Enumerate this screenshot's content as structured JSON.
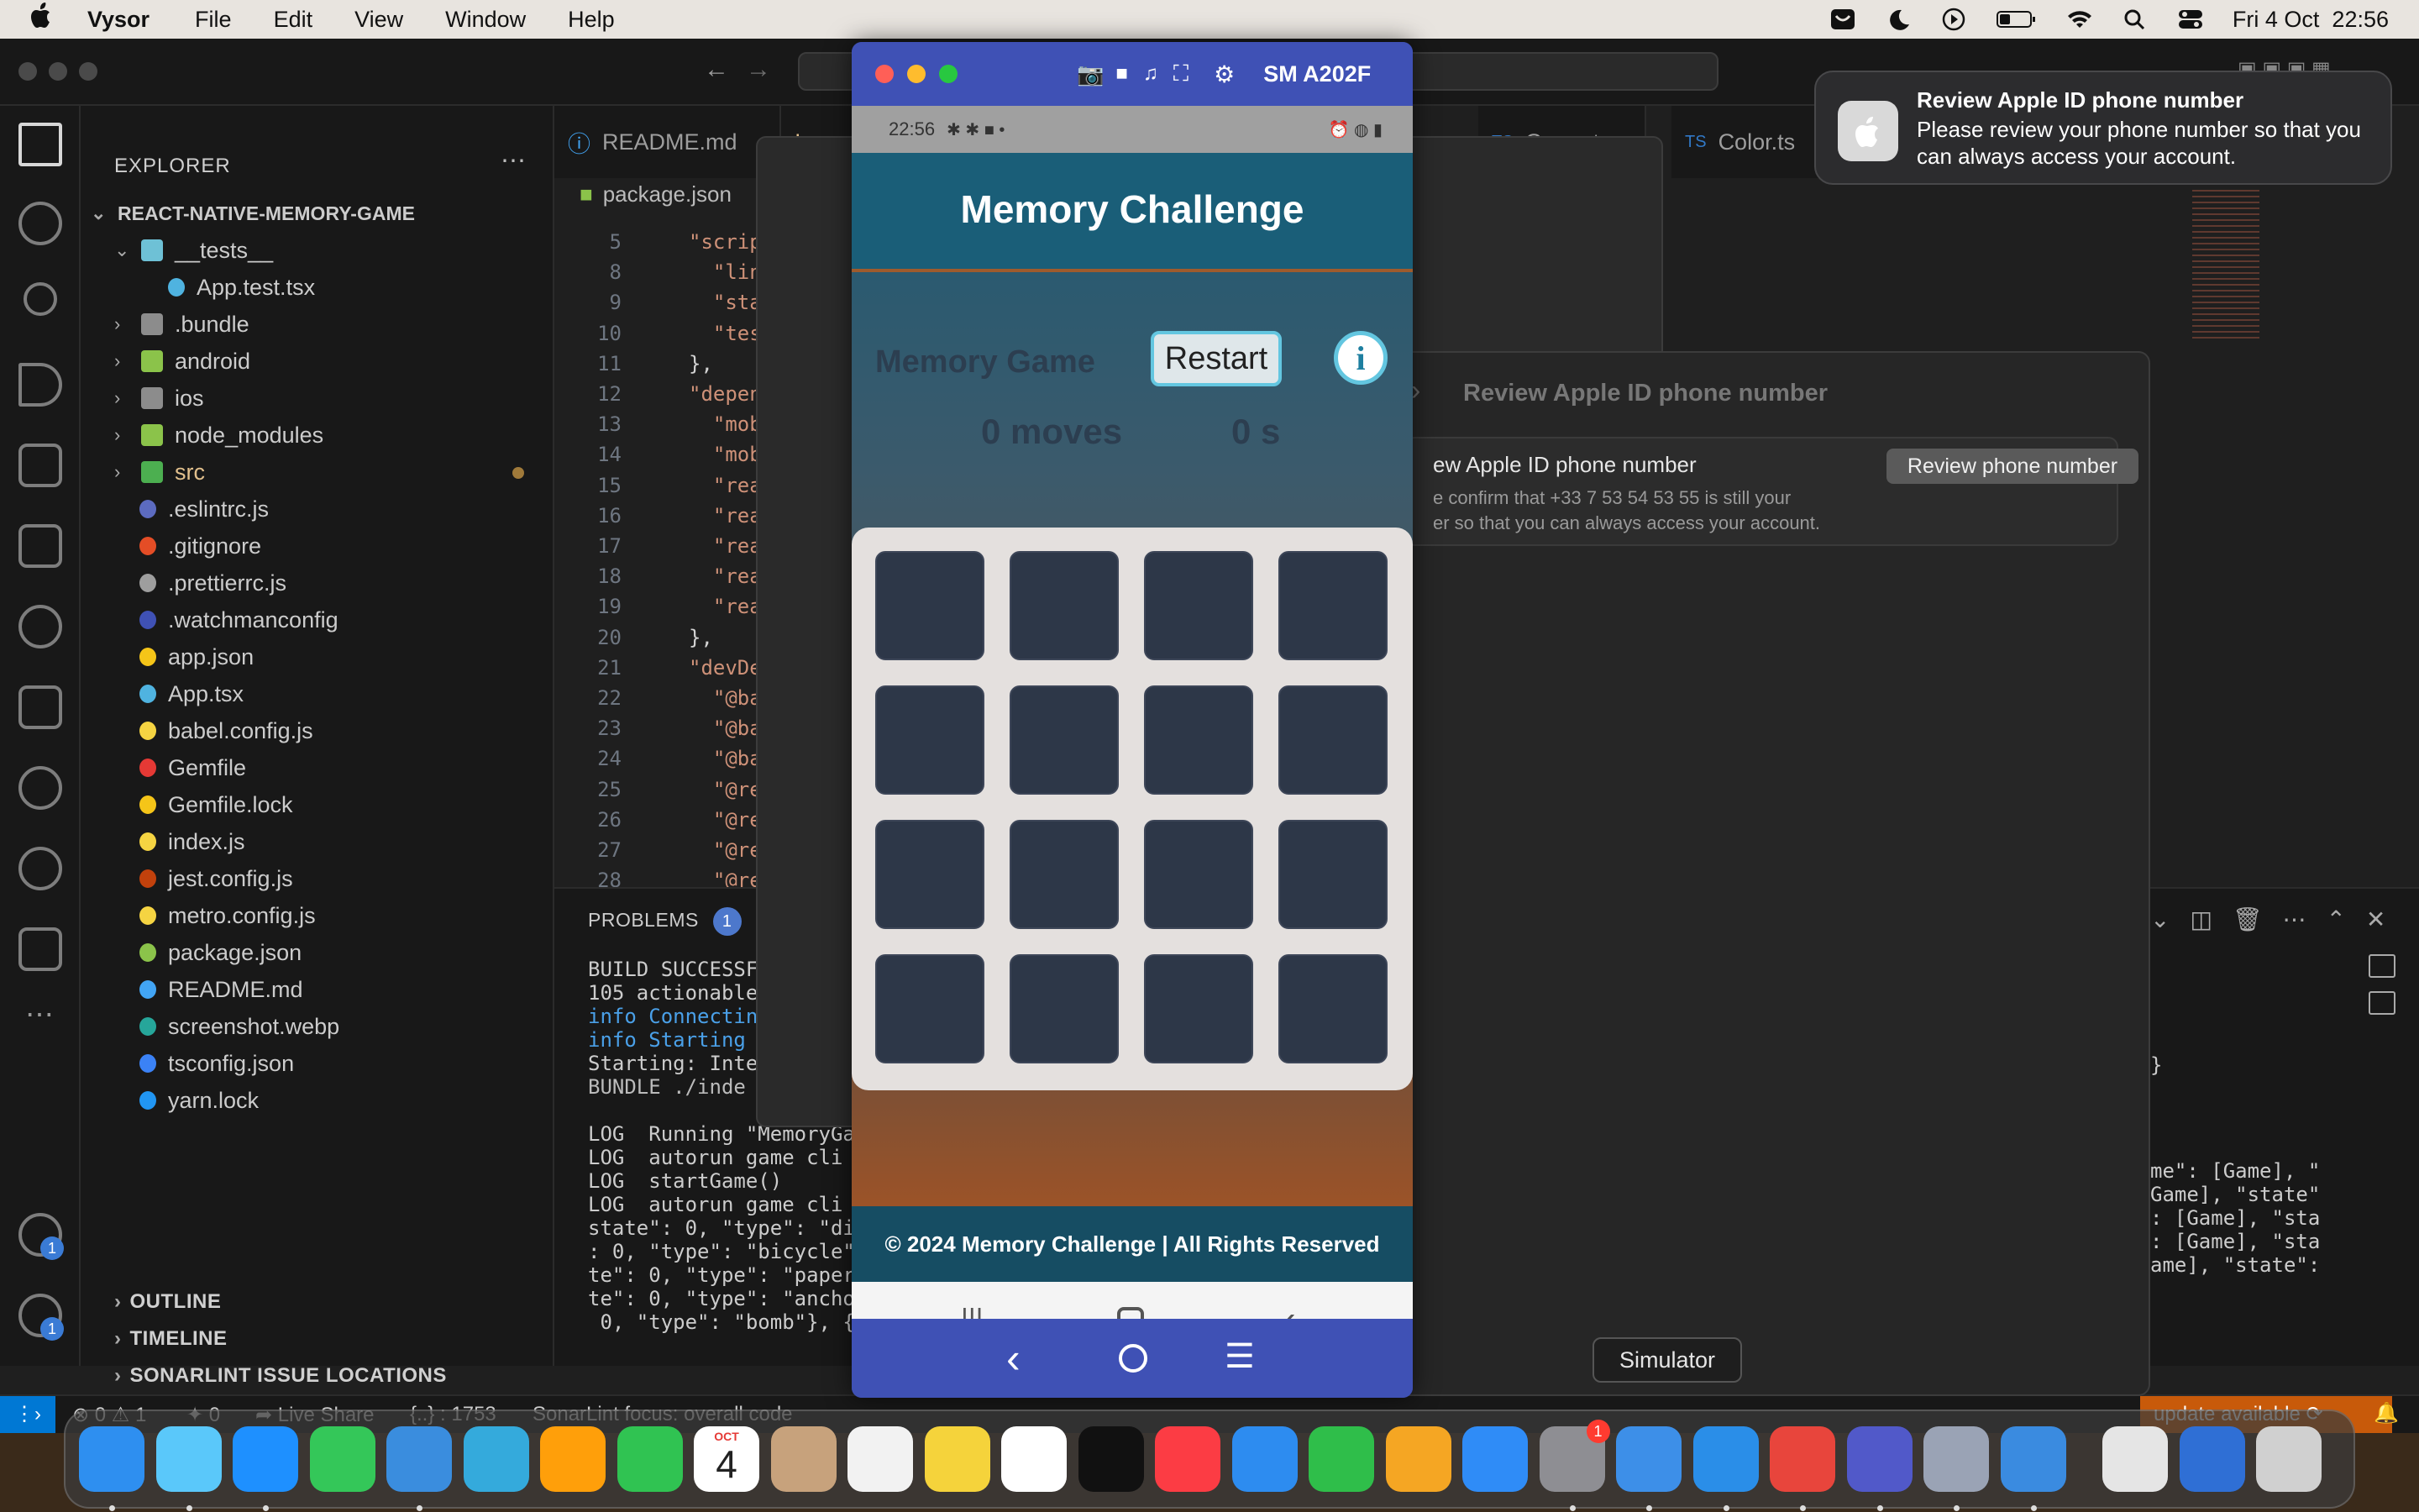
{
  "menubar": {
    "apple": "",
    "app": "Vysor",
    "items": [
      "File",
      "Edit",
      "View",
      "Window",
      "Help"
    ],
    "clock": "Fri 4 Oct  22:56"
  },
  "explorer": {
    "title": "EXPLORER",
    "project": "REACT-NATIVE-MEMORY-GAME",
    "items": [
      {
        "label": "__tests__",
        "kind": "folder-open",
        "depth": 1,
        "color": "#6ec1d6"
      },
      {
        "label": "App.test.tsx",
        "kind": "file",
        "depth": 2,
        "color": "#4fb3e0"
      },
      {
        "label": ".bundle",
        "kind": "folder",
        "depth": 1,
        "color": "#8c8c8c"
      },
      {
        "label": "android",
        "kind": "folder",
        "depth": 1,
        "color": "#8bc34a"
      },
      {
        "label": "ios",
        "kind": "folder",
        "depth": 1,
        "color": "#8c8c8c"
      },
      {
        "label": "node_modules",
        "kind": "folder",
        "depth": 1,
        "color": "#8bc34a"
      },
      {
        "label": "src",
        "kind": "folder",
        "depth": 1,
        "color": "#4caf50",
        "modified": true
      },
      {
        "label": ".eslintrc.js",
        "kind": "file",
        "depth": 1,
        "color": "#5c6bc0"
      },
      {
        "label": ".gitignore",
        "kind": "file",
        "depth": 1,
        "color": "#e44d26"
      },
      {
        "label": ".prettierrc.js",
        "kind": "file",
        "depth": 1,
        "color": "#9e9e9e"
      },
      {
        "label": ".watchmanconfig",
        "kind": "file",
        "depth": 1,
        "color": "#3f51b5"
      },
      {
        "label": "app.json",
        "kind": "file",
        "depth": 1,
        "color": "#f5c518"
      },
      {
        "label": "App.tsx",
        "kind": "file",
        "depth": 1,
        "color": "#4fb3e0"
      },
      {
        "label": "babel.config.js",
        "kind": "file",
        "depth": 1,
        "color": "#f5d442"
      },
      {
        "label": "Gemfile",
        "kind": "file",
        "depth": 1,
        "color": "#e53935"
      },
      {
        "label": "Gemfile.lock",
        "kind": "file",
        "depth": 1,
        "color": "#f5c518"
      },
      {
        "label": "index.js",
        "kind": "file",
        "depth": 1,
        "color": "#f5d442"
      },
      {
        "label": "jest.config.js",
        "kind": "file",
        "depth": 1,
        "color": "#c2410c"
      },
      {
        "label": "metro.config.js",
        "kind": "file",
        "depth": 1,
        "color": "#f5d442"
      },
      {
        "label": "package.json",
        "kind": "file",
        "depth": 1,
        "color": "#8bc34a"
      },
      {
        "label": "README.md",
        "kind": "file",
        "depth": 1,
        "color": "#42a5f5"
      },
      {
        "label": "screenshot.webp",
        "kind": "file",
        "depth": 1,
        "color": "#26a69a"
      },
      {
        "label": "tsconfig.json",
        "kind": "file",
        "depth": 1,
        "color": "#3b82f6"
      },
      {
        "label": "yarn.lock",
        "kind": "file",
        "depth": 1,
        "color": "#2196f3"
      }
    ],
    "sections": [
      "OUTLINE",
      "TIMELINE",
      "SONARLINT ISSUE LOCATIONS"
    ]
  },
  "editor": {
    "tabs": [
      "README.md",
      "In",
      "Game.ts",
      "Color.ts"
    ],
    "subtab": "package.json",
    "lines": [
      {
        "n": "5",
        "t": "\"scrip"
      },
      {
        "n": "8",
        "t": "  \"lin"
      },
      {
        "n": "9",
        "t": "  \"sta"
      },
      {
        "n": "10",
        "t": "  \"tes"
      },
      {
        "n": "11",
        "t": "},"
      },
      {
        "n": "12",
        "t": "\"depen"
      },
      {
        "n": "13",
        "t": "  \"mob"
      },
      {
        "n": "14",
        "t": "  \"mob"
      },
      {
        "n": "15",
        "t": "  \"rea"
      },
      {
        "n": "16",
        "t": "  \"rea"
      },
      {
        "n": "17",
        "t": "  \"rea"
      },
      {
        "n": "18",
        "t": "  \"rea"
      },
      {
        "n": "19",
        "t": "  \"rea"
      },
      {
        "n": "20",
        "t": "},"
      },
      {
        "n": "21",
        "t": "\"devDe"
      },
      {
        "n": "22",
        "t": "  \"@ba"
      },
      {
        "n": "23",
        "t": "  \"@ba"
      },
      {
        "n": "24",
        "t": "  \"@ba"
      },
      {
        "n": "25",
        "t": "  \"@re"
      },
      {
        "n": "26",
        "t": "  \"@re"
      },
      {
        "n": "27",
        "t": "  \"@re"
      },
      {
        "n": "28",
        "t": "  \"@re"
      },
      {
        "n": "29",
        "t": "  \"@ty"
      }
    ]
  },
  "panel": {
    "tab": "PROBLEMS",
    "badge": "1",
    "terminal": [
      "BUILD SUCCESSFU",
      "105 actionable",
      "info Connectin",
      "info Starting",
      "Starting: Inter",
      "BUNDLE ./inde",
      "",
      "LOG  Running \"MemoryGa",
      "LOG  autorun game cli",
      "LOG  startGame()",
      "LOG  autorun game cli",
      "state\": 0, \"type\": \"dia",
      ": 0, \"type\": \"bicycle\"",
      "te\": 0, \"type\": \"paper-",
      "te\": 0, \"type\": \"ancho",
      " 0, \"type\": \"bomb\"}, {\""
    ],
    "terminal_right": [
      "}",
      "me\": [Game], \"",
      "Game], \"state\"",
      ": [Game], \"sta",
      ": [Game], \"sta",
      "ame], \"state\":"
    ]
  },
  "statusbar": {
    "errors": "0",
    "warnings": "1",
    "ports": "0",
    "liveshare": "Live Share",
    "position": "{..} : 1753",
    "sonar": "SonarLint focus: overall code",
    "update": "update available"
  },
  "vysor": {
    "device": "SM A202F",
    "phone_time": "22:56",
    "app_title": "Memory Challenge",
    "game_label": "Memory Game",
    "restart": "Restart",
    "info": "i",
    "moves": "0 moves",
    "seconds": "0 s",
    "grid_rows": 4,
    "grid_cols": 4,
    "footer": "© 2024 Memory Challenge | All Rights Reserved"
  },
  "prefs": {
    "header": "Review Apple ID phone number",
    "item_title": "ew Apple ID phone number",
    "item_body1": "e confirm that +33 7 53 54 53 55 is still your",
    "item_body2": "er so that you can always access your account.",
    "button": "Review phone number"
  },
  "notification": {
    "title": "Review Apple ID phone number",
    "body": "Please review your phone number so that you can always access your account."
  },
  "dock": {
    "tooltip": "Simulator",
    "calendar_month": "OCT",
    "calendar_day": "4",
    "settings_badge": "1",
    "account_badge": "1",
    "apps": [
      "finder",
      "launchpad",
      "safari",
      "messages",
      "mail",
      "maps",
      "photos",
      "facetime",
      "calendar",
      "contacts",
      "reminders",
      "notes",
      "freeform",
      "tv",
      "music",
      "keynote",
      "numbers",
      "pages",
      "app-store",
      "system-settings",
      "simulator",
      "vscode",
      "chrome",
      "teams",
      "vysor",
      "xcode",
      "preview",
      "files",
      "trash"
    ],
    "colors": {
      "finder": "#2e8ff0",
      "messages": "#34c759",
      "mail": "#3a8dde",
      "facetime": "#30c352",
      "music": "#fc3c44",
      "keynote": "#2d8cf0",
      "numbers": "#2fbe4a",
      "pages": "#f5a623",
      "app-store": "#2f8cf7",
      "vscode": "#2a8ee8",
      "chrome": "#e8453c",
      "teams": "#5159c9"
    }
  }
}
